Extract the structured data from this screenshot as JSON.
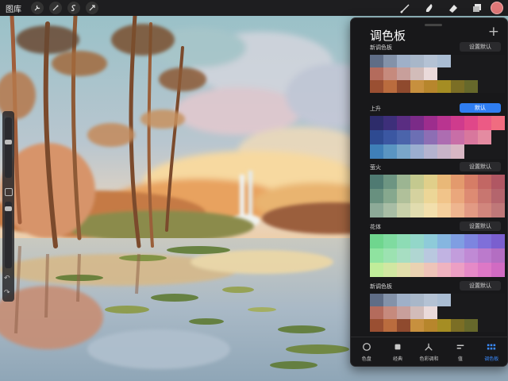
{
  "topbar": {
    "gallery_label": "图库",
    "left_icons": [
      "wrench-icon",
      "magic-wand-icon",
      "selection-icon",
      "transform-arrow-icon"
    ],
    "right_icons": [
      "brush-icon",
      "smudge-icon",
      "eraser-icon",
      "layers-icon"
    ],
    "current_color": "#e07878"
  },
  "panel": {
    "title": "调色板",
    "add_label": "+",
    "palettes": [
      {
        "name": "新调色板",
        "button": "设置默认",
        "active": false,
        "rows": [
          [
            "#5f6d86",
            "#8392a9",
            "#9fb0c8",
            "#a8b7c9",
            "#b4c2d4",
            "#aabdd3",
            "#1a1a1c",
            "#1a1a1c",
            "#1a1a1c",
            "#1a1a1c"
          ],
          [
            "#b46b5c",
            "#c68a7d",
            "#c89f9b",
            "#d2bcb9",
            "#eadada",
            "#1a1a1c",
            "#1a1a1c",
            "#1a1a1c",
            "#1a1a1c",
            "#1a1a1c"
          ],
          [
            "#9a4f32",
            "#ba6c3e",
            "#8f4a2e",
            "#c7903e",
            "#b7862c",
            "#a58d23",
            "#7b6e25",
            "#66682b",
            "#1a1a1c",
            "#1a1a1c"
          ]
        ]
      },
      {
        "name": "上升",
        "button": "默认",
        "active": true,
        "rows": [
          [
            "#2d2c6a",
            "#3d2f7a",
            "#5a2d82",
            "#7b2b88",
            "#9d2d8d",
            "#b93490",
            "#cf3b8d",
            "#e04789",
            "#ec5a85",
            "#f06c80"
          ],
          [
            "#2e4a91",
            "#3b57a2",
            "#4b64ab",
            "#6c6fb4",
            "#8d6eb4",
            "#ad6db1",
            "#c86ea7",
            "#d8779d",
            "#e48ba1",
            "#1a1a1c"
          ],
          [
            "#3f7fb8",
            "#5a95c2",
            "#7aa6c9",
            "#9baed0",
            "#b4b3cf",
            "#c8b4c8",
            "#d8b7c4",
            "#1a1a1c",
            "#1a1a1c",
            "#1a1a1c"
          ]
        ]
      },
      {
        "name": "萤火",
        "button": "设置默认",
        "active": false,
        "rows": [
          [
            "#4f7a72",
            "#6d9582",
            "#9cb592",
            "#c4c98f",
            "#e0cf8a",
            "#e9b878",
            "#e39a6d",
            "#d67d66",
            "#c26764",
            "#b05763"
          ],
          [
            "#68907f",
            "#86a88e",
            "#b0c09a",
            "#d5d29f",
            "#ecd697",
            "#f1c48a",
            "#eaa77c",
            "#dd8b73",
            "#c87670",
            "#b4656d"
          ],
          [
            "#8daa98",
            "#a8bda5",
            "#c8d0aa",
            "#e1dcaf",
            "#f2dfac",
            "#f4cf9c",
            "#eeb58f",
            "#e29a84",
            "#d1867d",
            "#bf7879"
          ]
        ]
      },
      {
        "name": "花体",
        "button": "设置默认",
        "active": false,
        "rows": [
          [
            "#6fd68e",
            "#7fdba0",
            "#8ddcb5",
            "#93d7c9",
            "#8ecbd9",
            "#86b6e0",
            "#7f9ee2",
            "#7d85e0",
            "#7f6fd9",
            "#7a5fcf"
          ],
          [
            "#8fe3a0",
            "#9ce2b1",
            "#a7dec2",
            "#b0d6d2",
            "#b9c8df",
            "#c1b3e2",
            "#c29ddc",
            "#c08ad5",
            "#bb7acc",
            "#b36ec2"
          ],
          [
            "#c0ed9a",
            "#d1e7a2",
            "#e1deab",
            "#ead2b2",
            "#eec4b9",
            "#efb3c0",
            "#ec9fc4",
            "#e58ac7",
            "#dd78c6",
            "#d16bc2"
          ]
        ]
      },
      {
        "name": "新调色板",
        "button": "设置默认",
        "active": false,
        "rows": [
          [
            "#5f6d86",
            "#8392a9",
            "#9fb0c8",
            "#a8b7c9",
            "#b4c2d4",
            "#aabdd3",
            "#1a1a1c",
            "#1a1a1c",
            "#1a1a1c",
            "#1a1a1c"
          ],
          [
            "#b46b5c",
            "#c68a7d",
            "#c89f9b",
            "#d2bcb9",
            "#eadada",
            "#1a1a1c",
            "#1a1a1c",
            "#1a1a1c",
            "#1a1a1c",
            "#1a1a1c"
          ],
          [
            "#9a4f32",
            "#ba6c3e",
            "#8f4a2e",
            "#c7903e",
            "#b7862c",
            "#a58d23",
            "#7b6e25",
            "#66682b",
            "#1a1a1c",
            "#1a1a1c"
          ]
        ]
      }
    ],
    "nav": [
      {
        "label": "色盘",
        "icon": "disc-icon"
      },
      {
        "label": "经典",
        "icon": "square-icon"
      },
      {
        "label": "色彩调和",
        "icon": "harmony-icon"
      },
      {
        "label": "值",
        "icon": "sliders-icon"
      },
      {
        "label": "调色板",
        "icon": "grid-icon"
      }
    ]
  }
}
